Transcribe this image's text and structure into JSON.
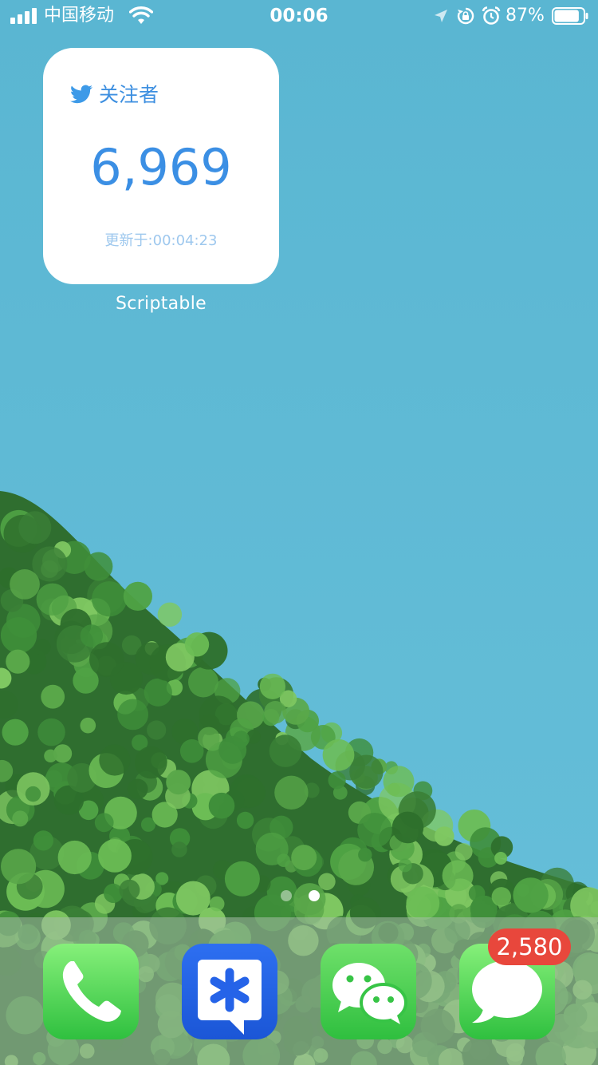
{
  "status_bar": {
    "carrier": "中国移动",
    "time": "00:06",
    "battery_percent": "87%",
    "battery_level": 0.87,
    "icons": [
      "signal-icon",
      "wifi-icon",
      "location-icon",
      "rotation-lock-icon",
      "alarm-icon",
      "battery-icon"
    ]
  },
  "widget": {
    "title": "关注者",
    "count": "6,969",
    "updated": "更新于:00:04:23",
    "label": "Scriptable",
    "accent": "#3b8fe4",
    "icon": "twitter-icon"
  },
  "page_indicator": {
    "pages": 2,
    "current": 2
  },
  "dock": {
    "apps": [
      {
        "name": "phone",
        "icon": "phone-icon"
      },
      {
        "name": "tim",
        "icon": "tim-icon"
      },
      {
        "name": "wechat",
        "icon": "wechat-icon"
      },
      {
        "name": "messages",
        "icon": "messages-icon",
        "badge": "2,580"
      }
    ],
    "badge_color": "#e8473c"
  }
}
